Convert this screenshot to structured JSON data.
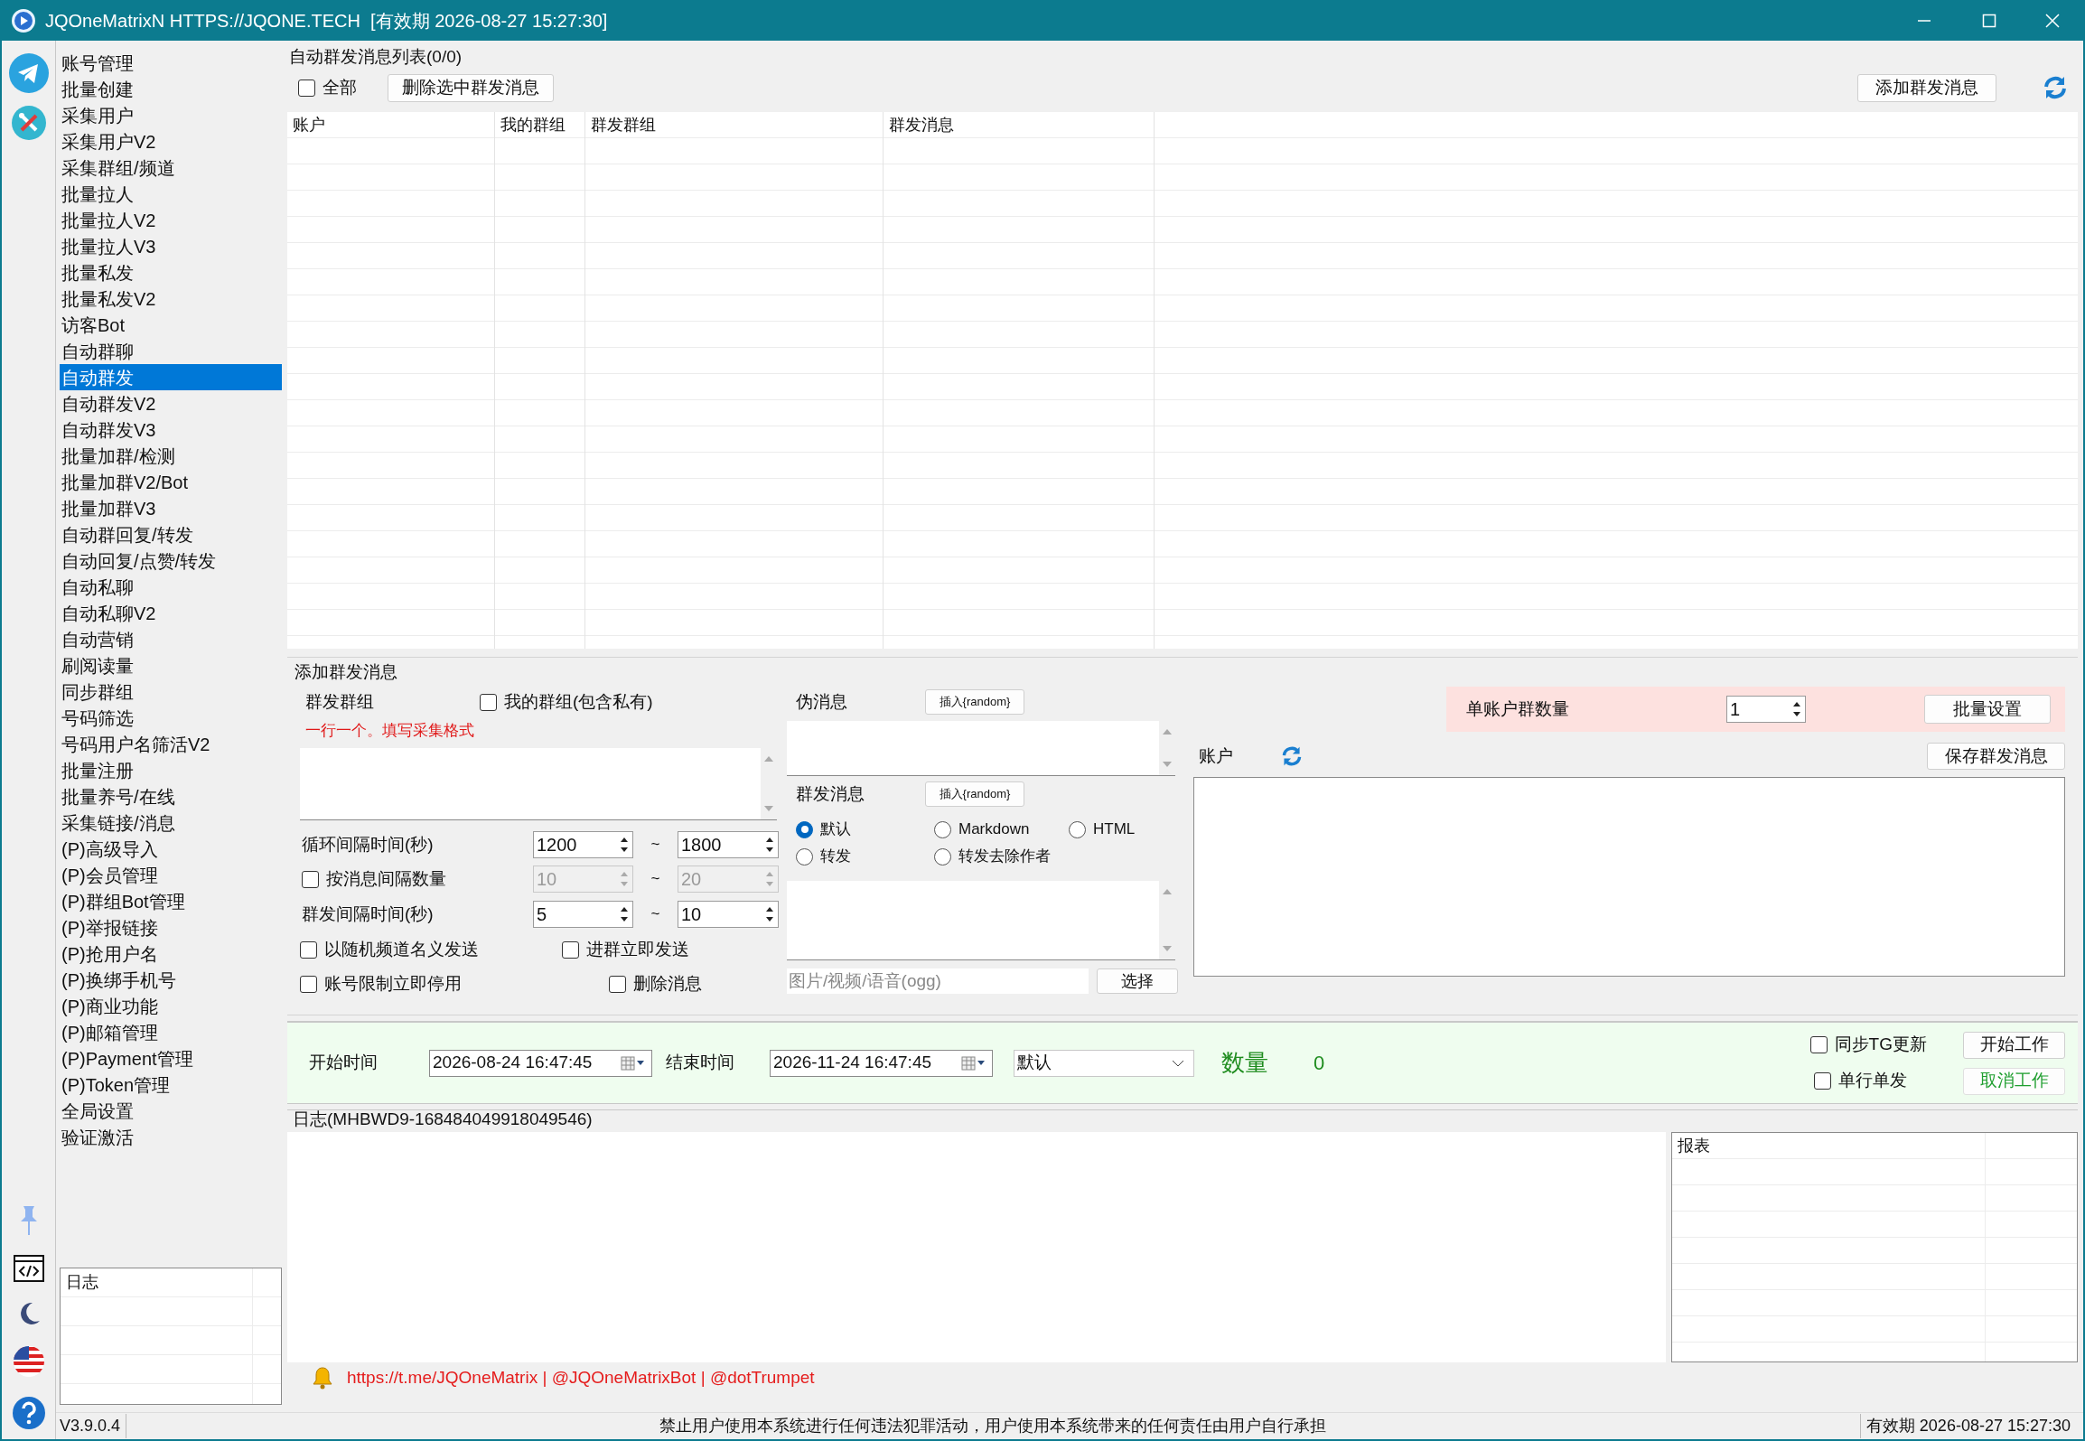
{
  "window": {
    "title": "JQOneMatrixN HTTPS://JQONE.TECH  [有效期 2026-08-27 15:27:30]"
  },
  "sidebar": {
    "items": [
      {
        "label": "账号管理",
        "selected": false
      },
      {
        "label": "批量创建",
        "selected": false
      },
      {
        "label": "采集用户",
        "selected": false
      },
      {
        "label": "采集用户V2",
        "selected": false
      },
      {
        "label": "采集群组/频道",
        "selected": false
      },
      {
        "label": "批量拉人",
        "selected": false
      },
      {
        "label": "批量拉人V2",
        "selected": false
      },
      {
        "label": "批量拉人V3",
        "selected": false
      },
      {
        "label": "批量私发",
        "selected": false
      },
      {
        "label": "批量私发V2",
        "selected": false
      },
      {
        "label": "访客Bot",
        "selected": false
      },
      {
        "label": "自动群聊",
        "selected": false
      },
      {
        "label": "自动群发",
        "selected": true
      },
      {
        "label": "自动群发V2",
        "selected": false
      },
      {
        "label": "自动群发V3",
        "selected": false
      },
      {
        "label": "批量加群/检测",
        "selected": false
      },
      {
        "label": "批量加群V2/Bot",
        "selected": false
      },
      {
        "label": "批量加群V3",
        "selected": false
      },
      {
        "label": "自动群回复/转发",
        "selected": false
      },
      {
        "label": "自动回复/点赞/转发",
        "selected": false
      },
      {
        "label": "自动私聊",
        "selected": false
      },
      {
        "label": "自动私聊V2",
        "selected": false
      },
      {
        "label": "自动营销",
        "selected": false
      },
      {
        "label": "刷阅读量",
        "selected": false
      },
      {
        "label": "同步群组",
        "selected": false
      },
      {
        "label": "号码筛选",
        "selected": false
      },
      {
        "label": "号码用户名筛活V2",
        "selected": false
      },
      {
        "label": "批量注册",
        "selected": false
      },
      {
        "label": "批量养号/在线",
        "selected": false
      },
      {
        "label": "采集链接/消息",
        "selected": false
      },
      {
        "label": "(P)高级导入",
        "selected": false
      },
      {
        "label": "(P)会员管理",
        "selected": false
      },
      {
        "label": "(P)群组Bot管理",
        "selected": false
      },
      {
        "label": "(P)举报链接",
        "selected": false
      },
      {
        "label": "(P)抢用户名",
        "selected": false
      },
      {
        "label": "(P)换绑手机号",
        "selected": false
      },
      {
        "label": "(P)商业功能",
        "selected": false
      },
      {
        "label": "(P)邮箱管理",
        "selected": false
      },
      {
        "label": "(P)Payment管理",
        "selected": false
      },
      {
        "label": "(P)Token管理",
        "selected": false
      },
      {
        "label": "全局设置",
        "selected": false
      },
      {
        "label": "验证激活",
        "selected": false
      }
    ],
    "log_panel": {
      "header": "日志"
    }
  },
  "message_list": {
    "title": "自动群发消息列表(0/0)",
    "select_all": {
      "label": "全部",
      "checked": false
    },
    "delete_button": "删除选中群发消息",
    "add_button": "添加群发消息",
    "columns": [
      "账户",
      "我的群组",
      "群发群组",
      "群发消息"
    ]
  },
  "add_form": {
    "title": "添加群发消息",
    "group_label": "群发群组",
    "my_groups": {
      "label": "我的群组(包含私有)",
      "checked": false
    },
    "hint": "一行一个。填写采集格式",
    "intervals": [
      {
        "kind": "label",
        "label": "循环间隔时间(秒)",
        "from": "1200",
        "separator": "~",
        "to": "1800",
        "disabled": false
      },
      {
        "kind": "checkbox",
        "label": "按消息间隔数量",
        "checked": false,
        "from": "10",
        "separator": "~",
        "to": "20",
        "disabled": true
      },
      {
        "kind": "label",
        "label": "群发间隔时间(秒)",
        "from": "5",
        "separator": "~",
        "to": "10",
        "disabled": false
      }
    ],
    "options": [
      {
        "label": "以随机频道名义发送",
        "checked": false
      },
      {
        "label": "进群立即发送",
        "checked": false
      },
      {
        "label": "账号限制立即停用",
        "checked": false
      },
      {
        "label": "删除消息",
        "checked": false
      }
    ],
    "fake_message": {
      "label": "伪消息",
      "insert_button": "插入{random}"
    },
    "message": {
      "label": "群发消息",
      "insert_button": "插入{random}",
      "formats": [
        {
          "label": "默认",
          "selected": true
        },
        {
          "label": "Markdown",
          "selected": false
        },
        {
          "label": "HTML",
          "selected": false
        },
        {
          "label": "转发",
          "selected": false
        },
        {
          "label": "转发去除作者",
          "selected": false
        }
      ],
      "media": {
        "placeholder": "图片/视频/语音(ogg)"
      },
      "choose_button": "选择"
    },
    "per_account": {
      "label": "单账户群数量",
      "value": "1",
      "button": "批量设置"
    },
    "accounts": {
      "label": "账户",
      "save_button": "保存群发消息"
    }
  },
  "work_bar": {
    "start_label": "开始时间",
    "start": "2026-08-24 16:47:45",
    "end_label": "结束时间",
    "end": "2026-11-24 16:47:45",
    "mode": "默认",
    "count_label": "数量",
    "count": "0",
    "options": [
      {
        "label": "同步TG更新",
        "checked": false
      },
      {
        "label": "单行单发",
        "checked": false
      }
    ],
    "start_button": "开始工作",
    "cancel_button": "取消工作"
  },
  "log": {
    "title": "日志(MHBWD9-168484049918049546)",
    "report_header": "报表",
    "links": "https://t.me/JQOneMatrix | @JQOneMatrixBot | @dotTrumpet"
  },
  "status_bar": {
    "version": "V3.9.0.4",
    "notice": "禁止用户使用本系统进行任何违法犯罪活动，用户使用本系统带来的任何责任由用户自行承担",
    "expiry": "有效期 2026-08-27 15:27:30"
  }
}
